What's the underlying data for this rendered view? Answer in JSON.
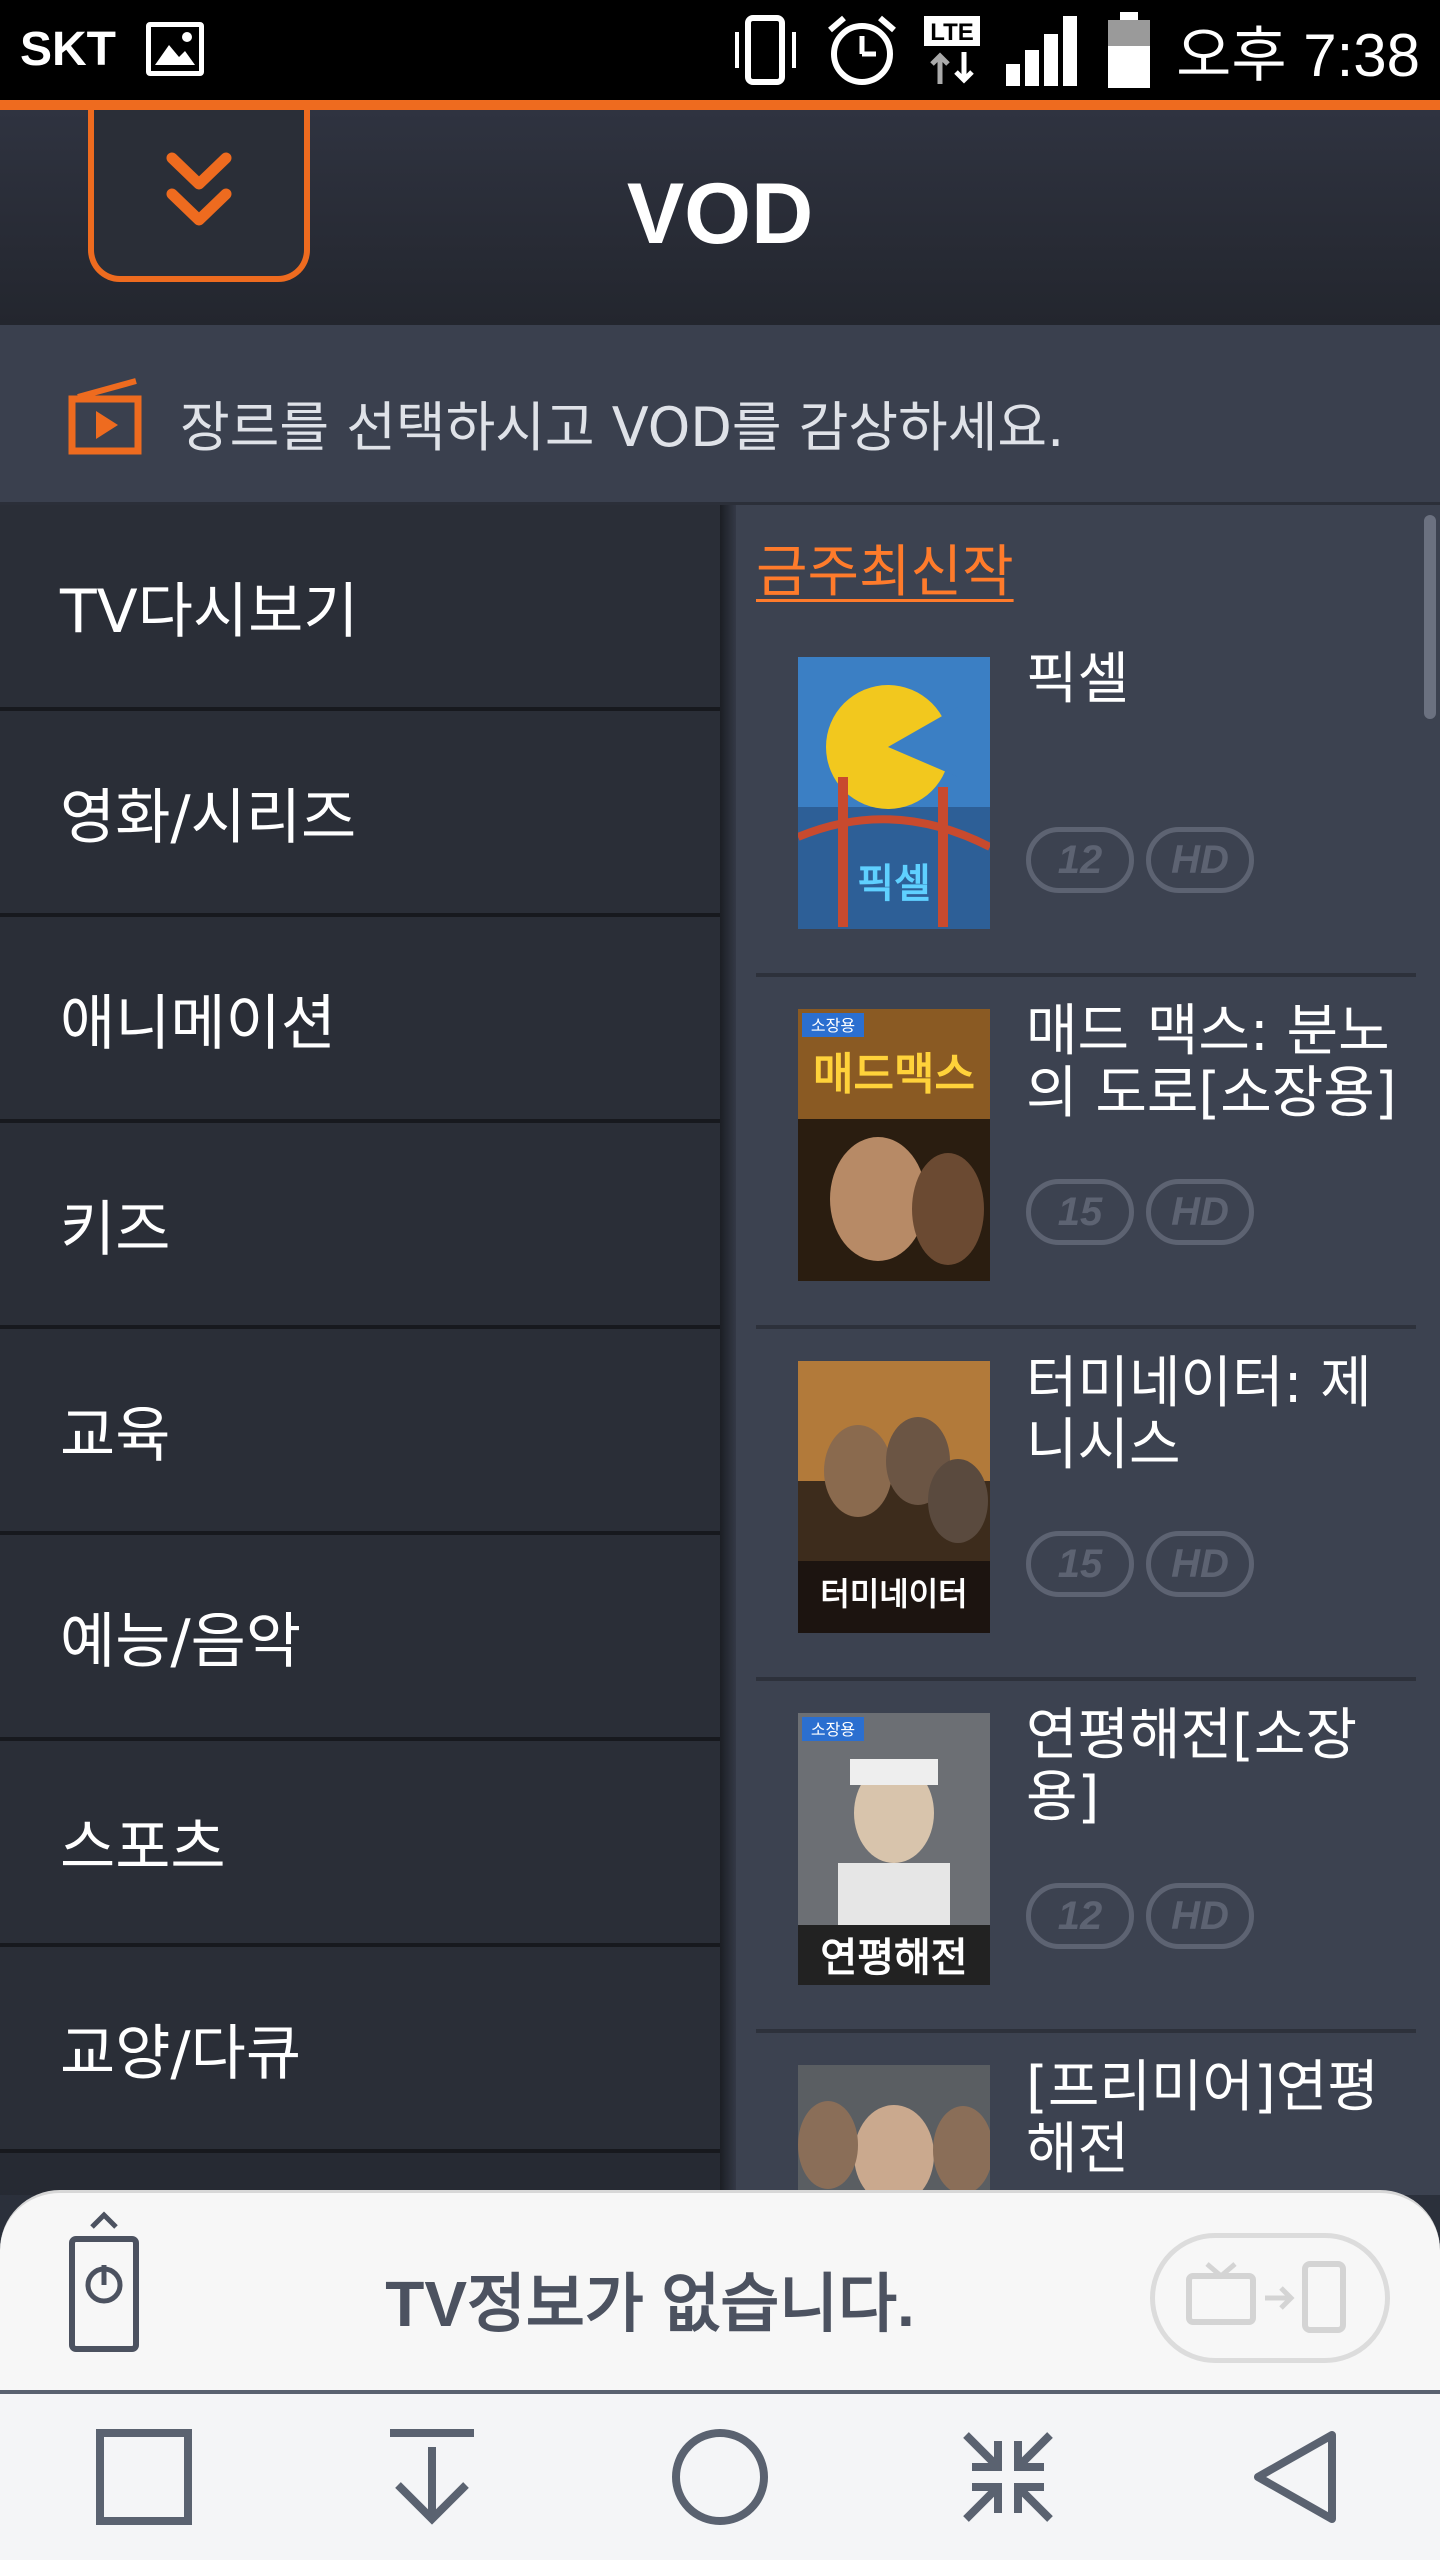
{
  "status_bar": {
    "carrier": "SKT",
    "time": "오후 7:38",
    "network": "LTE",
    "icons": [
      "gallery-icon",
      "vibrate-icon",
      "alarm-icon",
      "lte-icon",
      "signal-icon",
      "battery-icon"
    ]
  },
  "header": {
    "title": "VOD",
    "collapse_icon": "double-chevron-down-icon"
  },
  "banner": {
    "text": "장르를 선택하시고 VOD를 감상하세요.",
    "icon": "tv-play-icon"
  },
  "genres": [
    "TV다시보기",
    "영화/시리즈",
    "애니메이션",
    "키즈",
    "교육",
    "예능/음악",
    "스포츠",
    "교양/다큐"
  ],
  "section": {
    "title": "금주최신작"
  },
  "movies": [
    {
      "title": "픽셀",
      "rating": "12",
      "quality": "HD",
      "poster_text": "픽셀",
      "poster_tag": ""
    },
    {
      "title": "매드 맥스: 분노의 도로[소장용]",
      "rating": "15",
      "quality": "HD",
      "poster_text": "매드맥스",
      "poster_tag": "소장용"
    },
    {
      "title": "터미네이터: 제니시스",
      "rating": "15",
      "quality": "HD",
      "poster_text": "터미네이터",
      "poster_tag": ""
    },
    {
      "title": "연평해전[소장용]",
      "rating": "12",
      "quality": "HD",
      "poster_text": "연평해전",
      "poster_tag": "소장용"
    },
    {
      "title": "[프리미어]연평해전",
      "rating": "",
      "quality": "",
      "poster_text": "",
      "poster_tag": ""
    }
  ],
  "remote": {
    "text": "TV정보가 없습니다.",
    "icons": [
      "remote-power-icon",
      "tv-to-phone-icon"
    ]
  },
  "navbar": {
    "buttons": [
      "recent-apps-button",
      "download-button",
      "home-button",
      "collapse-button",
      "back-button"
    ]
  },
  "colors": {
    "accent": "#ee6b1f",
    "background": "#2b303b"
  }
}
